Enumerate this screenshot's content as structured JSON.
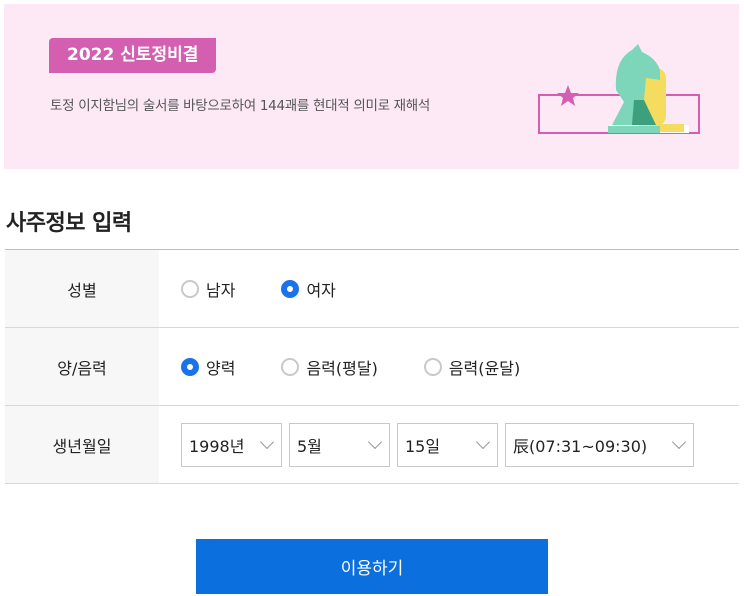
{
  "banner": {
    "badge": "2022 신토정비결",
    "description": "토정 이지함님의 술서를 바탕으로하여 144괘를 현대적 의미로 재해석"
  },
  "section": {
    "title": "사주정보 입력"
  },
  "form": {
    "gender": {
      "label": "성별",
      "options": [
        {
          "label": "남자",
          "selected": false
        },
        {
          "label": "여자",
          "selected": true
        }
      ]
    },
    "calendar": {
      "label": "양/음력",
      "options": [
        {
          "label": "양력",
          "selected": true
        },
        {
          "label": "음력(평달)",
          "selected": false
        },
        {
          "label": "음력(윤달)",
          "selected": false
        }
      ]
    },
    "birth": {
      "label": "생년월일",
      "year": "1998년",
      "month": "5월",
      "day": "15일",
      "hour": "辰(07:31~09:30)"
    }
  },
  "submit": {
    "label": "이용하기"
  },
  "colors": {
    "accent": "#1a73e8",
    "button": "#0b6fde",
    "badge": "#d45fb0",
    "banner_bg": "#fde9f6"
  }
}
